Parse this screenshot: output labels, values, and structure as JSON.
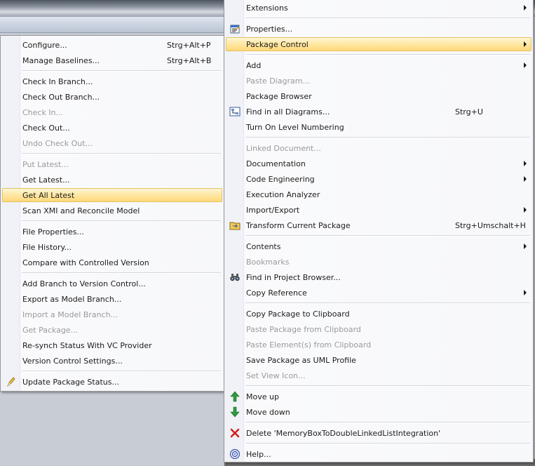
{
  "left_menu": {
    "items": [
      {
        "label": "Configure...",
        "shortcut": "Strg+Alt+P"
      },
      {
        "label": "Manage Baselines...",
        "shortcut": "Strg+Alt+B"
      },
      {
        "label": "Check In Branch..."
      },
      {
        "label": "Check Out Branch..."
      },
      {
        "label": "Check In..."
      },
      {
        "label": "Check Out..."
      },
      {
        "label": "Undo Check Out..."
      },
      {
        "label": "Put Latest..."
      },
      {
        "label": "Get Latest..."
      },
      {
        "label": "Get All Latest"
      },
      {
        "label": "Scan XMI and Reconcile Model"
      },
      {
        "label": "File Properties..."
      },
      {
        "label": "File History..."
      },
      {
        "label": "Compare with Controlled Version"
      },
      {
        "label": "Add Branch to Version Control..."
      },
      {
        "label": "Export as Model Branch..."
      },
      {
        "label": "Import a Model Branch..."
      },
      {
        "label": "Get Package..."
      },
      {
        "label": "Re-synch Status With VC Provider"
      },
      {
        "label": "Version Control Settings..."
      },
      {
        "label": "Update Package Status..."
      }
    ]
  },
  "right_menu": {
    "items": [
      {
        "label": "Extensions"
      },
      {
        "label": "Properties..."
      },
      {
        "label": "Package Control"
      },
      {
        "label": "Add"
      },
      {
        "label": "Paste Diagram..."
      },
      {
        "label": "Package Browser"
      },
      {
        "label": "Find in all Diagrams...",
        "shortcut": "Strg+U"
      },
      {
        "label": "Turn On Level Numbering"
      },
      {
        "label": "Linked Document..."
      },
      {
        "label": "Documentation"
      },
      {
        "label": "Code Engineering"
      },
      {
        "label": "Execution Analyzer"
      },
      {
        "label": "Import/Export"
      },
      {
        "label": "Transform Current Package",
        "shortcut": "Strg+Umschalt+H"
      },
      {
        "label": "Contents"
      },
      {
        "label": "Bookmarks"
      },
      {
        "label": "Find in Project Browser..."
      },
      {
        "label": "Copy Reference"
      },
      {
        "label": "Copy Package to Clipboard"
      },
      {
        "label": "Paste Package from Clipboard"
      },
      {
        "label": "Paste Element(s) from Clipboard"
      },
      {
        "label": "Save Package as UML Profile"
      },
      {
        "label": "Set View Icon..."
      },
      {
        "label": "Move up"
      },
      {
        "label": "Move down"
      },
      {
        "label": "Delete 'MemoryBoxToDoubleLinkedListIntegration'"
      },
      {
        "label": "Help..."
      }
    ]
  },
  "icons": {
    "properties": "properties-icon",
    "find_diagrams": "find-diagrams-icon",
    "transform": "transform-folder-icon",
    "find_browser": "binoculars-icon",
    "move_up": "arrow-up-icon",
    "move_down": "arrow-down-icon",
    "delete": "delete-x-icon",
    "help": "help-icon",
    "update_status": "pencil-icon"
  },
  "colors": {
    "highlight": "#ffe7a2",
    "disabled_text": "#9a9a9a",
    "move_arrow": "#2e9a3c",
    "delete": "#d42020"
  }
}
